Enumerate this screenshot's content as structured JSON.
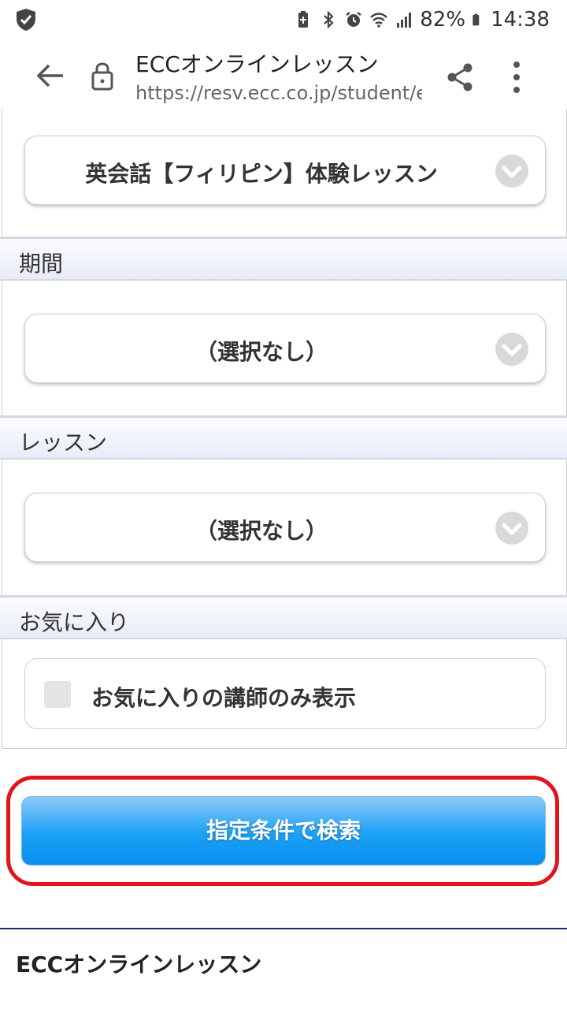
{
  "status_bar": {
    "battery": "82%",
    "time": "14:38",
    "icons": [
      "shield-icon",
      "battery-saver-icon",
      "bluetooth-icon",
      "alarm-icon",
      "wifi-icon",
      "signal-icon",
      "battery-icon"
    ]
  },
  "browser": {
    "title": "ECCオンラインレッスン",
    "url": "https://resv.ecc.co.jp/student/e",
    "icons": [
      "back-arrow-icon",
      "lock-icon",
      "share-icon",
      "more-vert-icon"
    ]
  },
  "form": {
    "course_select": "英会話【フィリピン】体験レッスン",
    "period": {
      "heading": "期間",
      "value": "（選択なし）"
    },
    "lesson": {
      "heading": "レッスン",
      "value": "（選択なし）"
    },
    "favorite": {
      "heading": "お気に入り",
      "checkbox_label": "お気に入りの講師のみ表示",
      "checked": false
    },
    "search_button": "指定条件で検索"
  },
  "footer": {
    "brand": "ECCオンラインレッスン"
  },
  "colors": {
    "search_button": "#1aa0f5",
    "highlight": "#e0141a",
    "footer_line": "#1d2a6b",
    "section_bg": "#e8ecf7"
  }
}
